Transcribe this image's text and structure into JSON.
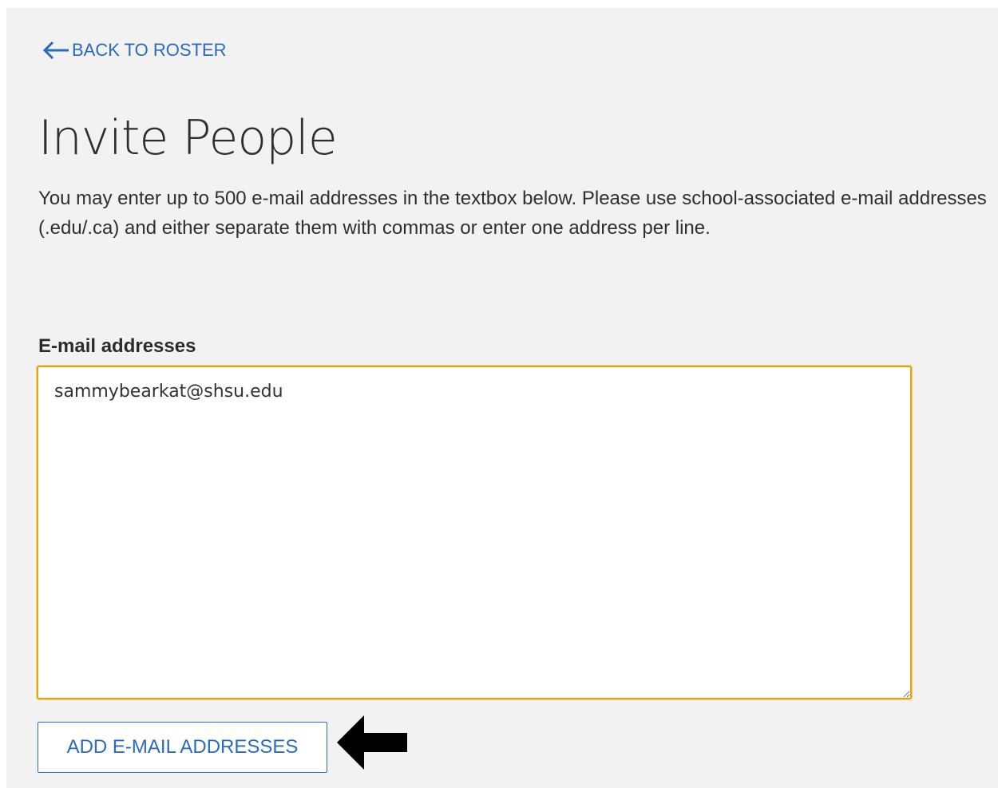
{
  "nav": {
    "back_label": "BACK TO ROSTER",
    "back_icon": "arrow-left-icon"
  },
  "page": {
    "title": "Invite People",
    "description": "You may enter up to 500 e-mail addresses in the textbox below. Please use school-associated e-mail addresses (.edu/.ca) and either separate them with commas or enter one address per line."
  },
  "form": {
    "email_label": "E-mail addresses",
    "email_value": "sammybearkat@shsu.edu",
    "submit_label": "ADD E-MAIL ADDRESSES"
  },
  "annotation": {
    "pointer_icon": "arrow-left-pointer-icon"
  },
  "colors": {
    "accent_blue": "#2a6bbf",
    "focus_border": "#e3a21a",
    "page_background": "#f2f2f2"
  }
}
